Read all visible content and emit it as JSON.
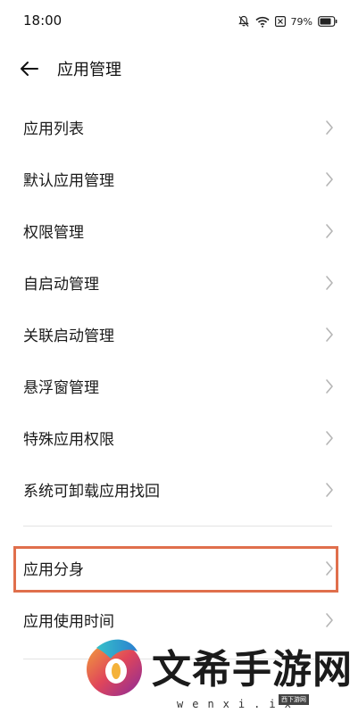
{
  "status_bar": {
    "time": "18:00",
    "battery_percent": "79%",
    "icons": [
      "notifications-off-icon",
      "wifi-icon",
      "close-box-icon",
      "battery-icon"
    ]
  },
  "header": {
    "back_icon": "back-arrow-icon",
    "title": "应用管理"
  },
  "menu": {
    "items": [
      {
        "label": "应用列表"
      },
      {
        "label": "默认应用管理"
      },
      {
        "label": "权限管理"
      },
      {
        "label": "自启动管理"
      },
      {
        "label": "关联启动管理"
      },
      {
        "label": "悬浮窗管理"
      },
      {
        "label": "特殊应用权限"
      },
      {
        "label": "系统可卸载应用找回"
      },
      {
        "label": "应用分身"
      },
      {
        "label": "应用使用时间"
      }
    ],
    "chevron_icon": "chevron-right-icon"
  },
  "annotation": {
    "highlight_color": "#e06f4c"
  },
  "watermark": {
    "title": "文希手游网",
    "url": "wenxi.ix",
    "badge": "西下游网"
  }
}
